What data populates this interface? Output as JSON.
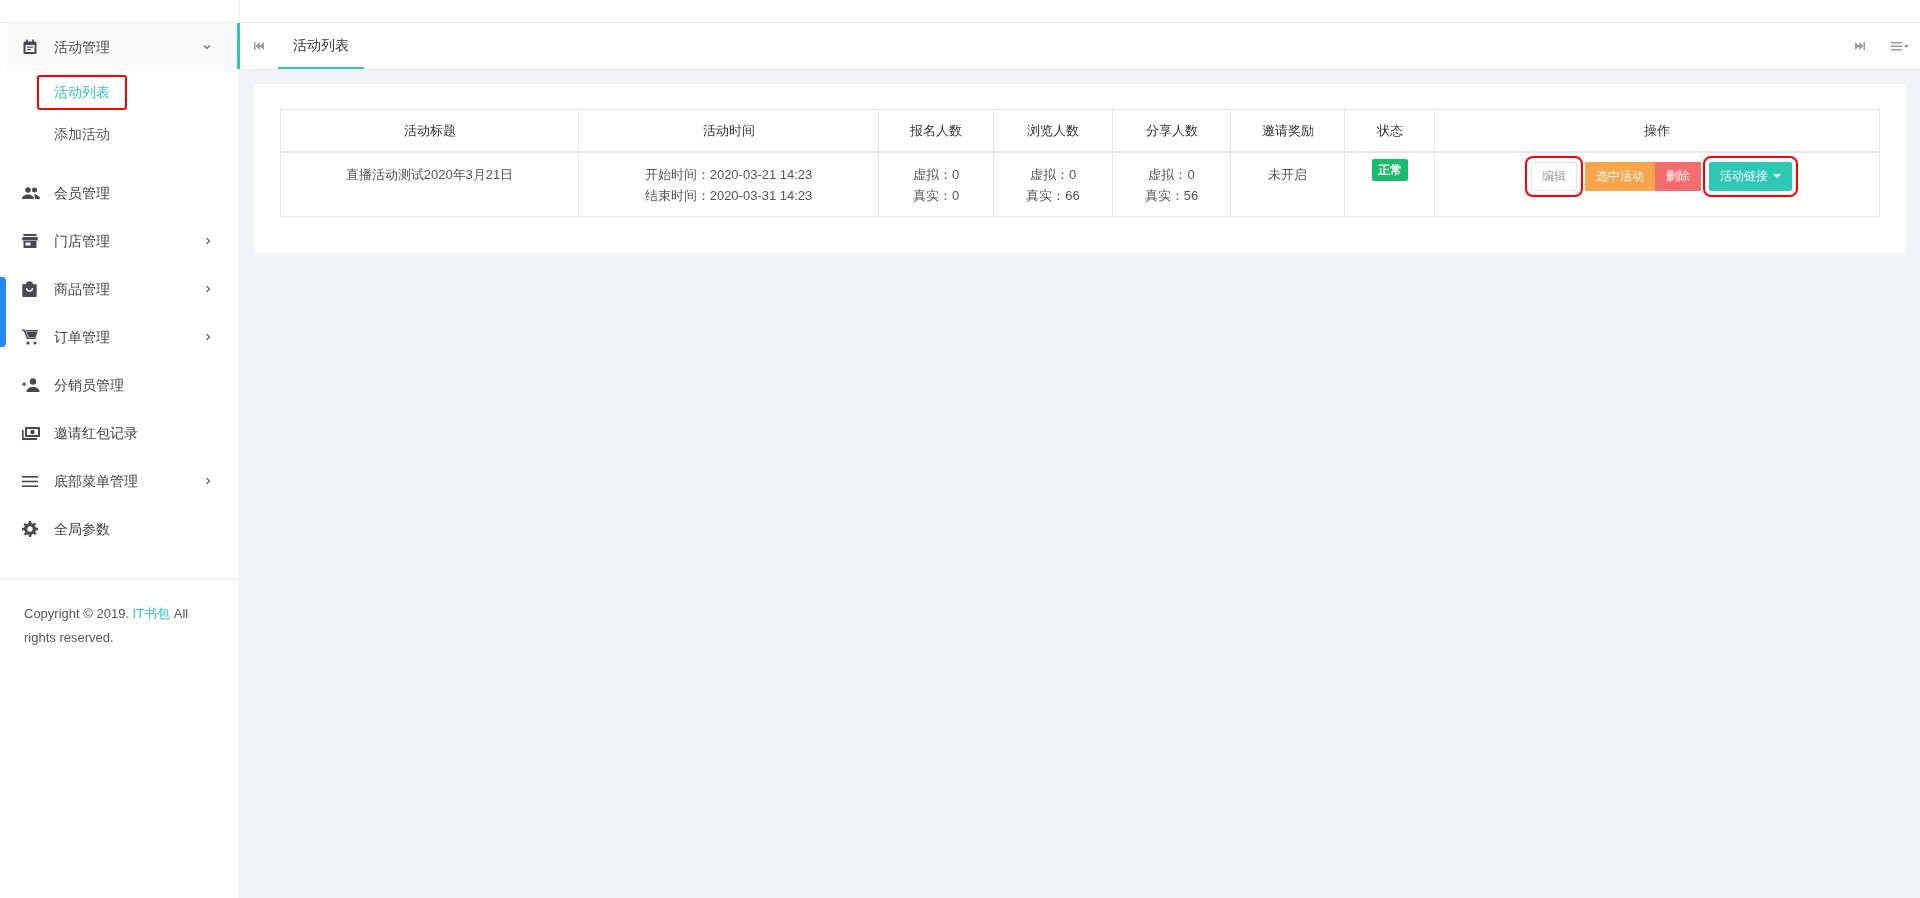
{
  "sidebar": {
    "items": [
      {
        "label": "活动管理",
        "expanded": true,
        "has_arrow": true,
        "children": [
          {
            "label": "活动列表",
            "selected": true,
            "highlighted": true
          },
          {
            "label": "添加活动",
            "selected": false,
            "highlighted": false
          }
        ]
      },
      {
        "label": "会员管理",
        "has_arrow": false
      },
      {
        "label": "门店管理",
        "has_arrow": true,
        "expanded": false
      },
      {
        "label": "商品管理",
        "has_arrow": true,
        "expanded": false
      },
      {
        "label": "订单管理",
        "has_arrow": true,
        "expanded": false
      },
      {
        "label": "分销员管理",
        "has_arrow": false
      },
      {
        "label": "邀请红包记录",
        "has_arrow": false
      },
      {
        "label": "底部菜单管理",
        "has_arrow": true,
        "expanded": false
      },
      {
        "label": "全局参数",
        "has_arrow": false
      }
    ],
    "footer": {
      "before": "Copyright © 2019. ",
      "link": "IT书包",
      "after": " All rights reserved."
    }
  },
  "tabs": [
    {
      "label": "活动列表",
      "selected": true
    }
  ],
  "table": {
    "columns": [
      "活动标题",
      "活动时间",
      "报名人数",
      "浏览人数",
      "分享人数",
      "邀请奖励",
      "状态",
      "操作"
    ],
    "rows": [
      {
        "title": "直播活动测试2020年3月21日",
        "time": [
          "开始时间：2020-03-21 14:23",
          "结束时间：2020-03-31 14:23"
        ],
        "signup": [
          "虚拟：0",
          "真实：0"
        ],
        "views": [
          "虚拟：0",
          "真实：66"
        ],
        "shares": [
          "虚拟：0",
          "真实：56"
        ],
        "reward": "未开启",
        "status": "正常",
        "actions": [
          {
            "label": "编辑",
            "kind": "plain",
            "highlighted": true,
            "caret": false
          },
          {
            "label": "选中活动",
            "kind": "warning",
            "highlighted": false,
            "caret": false
          },
          {
            "label": "删除",
            "kind": "danger",
            "highlighted": false,
            "caret": false
          },
          {
            "label": "活动链接",
            "kind": "primary",
            "highlighted": true,
            "caret": true
          }
        ]
      }
    ]
  }
}
